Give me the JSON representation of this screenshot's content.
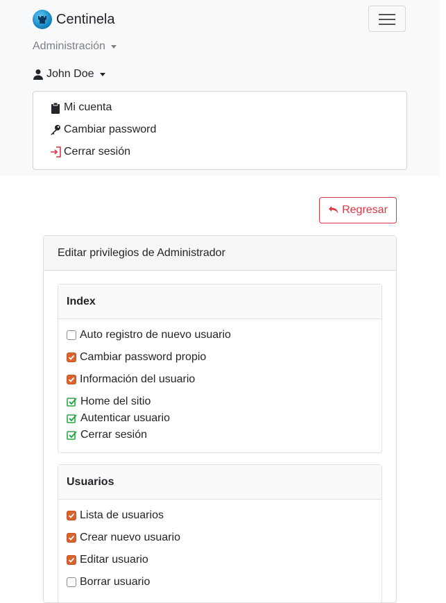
{
  "brand": {
    "name": "Centinela"
  },
  "nav": {
    "admin_label": "Administración",
    "user_label": "John Doe",
    "user_menu": [
      {
        "label": "Mi cuenta",
        "icon": "clipboard-icon"
      },
      {
        "label": "Cambiar password",
        "icon": "key-icon"
      },
      {
        "label": "Cerrar sesión",
        "icon": "logout-icon"
      }
    ]
  },
  "actions": {
    "return_label": "Regresar"
  },
  "card": {
    "title": "Editar privilegios de Administrador"
  },
  "sections": [
    {
      "title": "Index",
      "items": [
        {
          "label": "Auto registro de nuevo usuario",
          "state": "unchecked"
        },
        {
          "label": "Cambiar password propio",
          "state": "checked"
        },
        {
          "label": "Información del usuario",
          "state": "checked"
        },
        {
          "label": "Home del sitio",
          "state": "fixed"
        },
        {
          "label": "Autenticar usuario",
          "state": "fixed"
        },
        {
          "label": "Cerrar sesión",
          "state": "fixed"
        }
      ]
    },
    {
      "title": "Usuarios",
      "items": [
        {
          "label": "Lista de usuarios",
          "state": "checked"
        },
        {
          "label": "Crear nuevo usuario",
          "state": "checked"
        },
        {
          "label": "Editar usuario",
          "state": "checked"
        },
        {
          "label": "Borrar usuario",
          "state": "unchecked"
        }
      ]
    }
  ],
  "colors": {
    "danger": "#dc3545",
    "checked": "#d8642f",
    "fixed": "#28a745",
    "navbar_bg": "#f8f9fa"
  }
}
